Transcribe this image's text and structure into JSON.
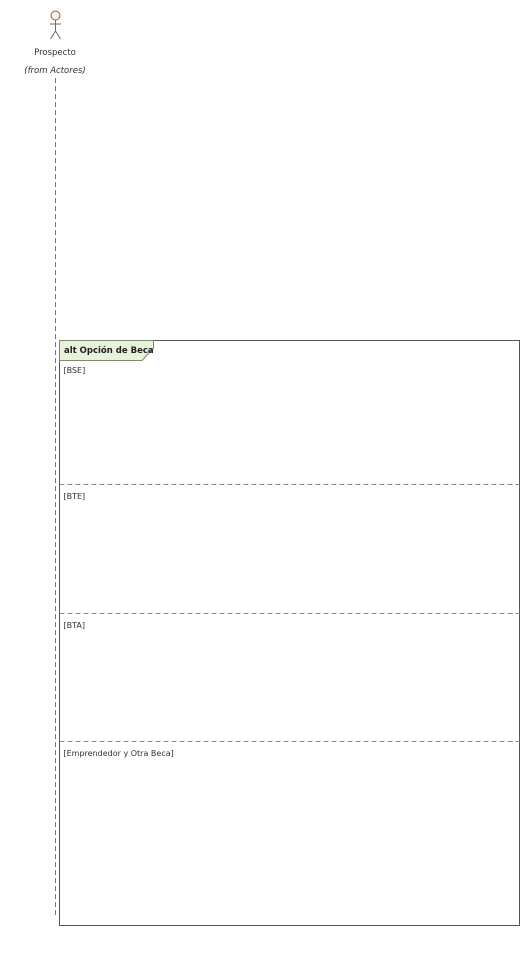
{
  "actor": {
    "name": "Prospecto",
    "origin": "(from Actores)"
  },
  "fragment": {
    "operator": "alt",
    "title": "alt Opción de Beca",
    "operands": [
      {
        "guard": "[BSE]"
      },
      {
        "guard": "[BTE]"
      },
      {
        "guard": "[BTA]"
      },
      {
        "guard": "[Emprendedor y Otra Beca]"
      }
    ]
  },
  "colors": {
    "actor_stroke": "#7a6a5a",
    "actor_head_fill": "#fbefe6",
    "frame_stroke": "#555555",
    "frame_label_fill": "#e6f2da",
    "frame_label_stroke": "#7a8a6a",
    "lifeline": "#777777",
    "divider": "#888888"
  }
}
